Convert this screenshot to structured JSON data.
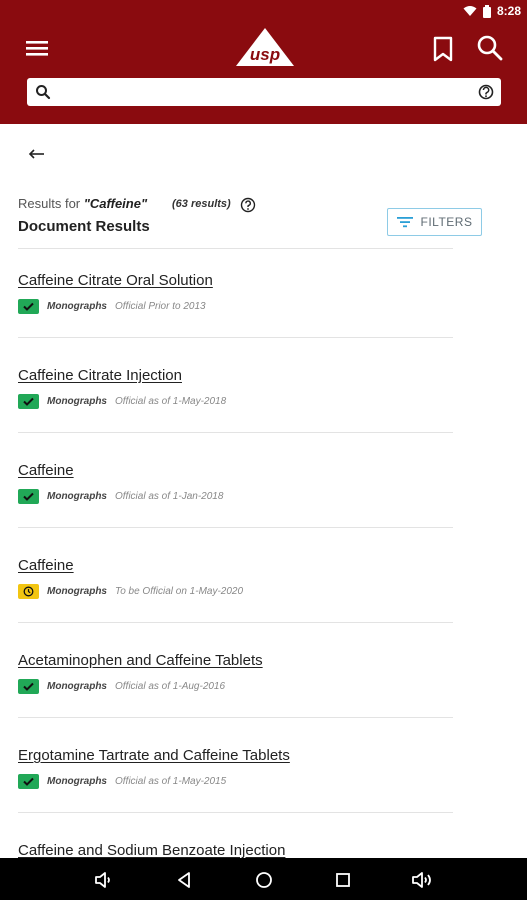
{
  "status_bar": {
    "time": "8:28"
  },
  "search": {
    "value": "",
    "placeholder": ""
  },
  "results": {
    "prefix": "Results for ",
    "term": "\"Caffeine\"",
    "count": "(63 results)",
    "section_title": "Document Results",
    "filters_label": "FILTERS"
  },
  "items": [
    {
      "title": "Caffeine Citrate Oral Solution",
      "type": "Monographs",
      "status": "Official Prior to 2013",
      "badge": "check"
    },
    {
      "title": "Caffeine Citrate Injection",
      "type": "Monographs",
      "status": "Official as of 1-May-2018",
      "badge": "check"
    },
    {
      "title": "Caffeine",
      "type": "Monographs",
      "status": "Official as of 1-Jan-2018",
      "badge": "check"
    },
    {
      "title": "Caffeine",
      "type": "Monographs",
      "status": "To be Official on 1-May-2020",
      "badge": "clock"
    },
    {
      "title": "Acetaminophen and Caffeine Tablets",
      "type": "Monographs",
      "status": "Official as of 1-Aug-2016",
      "badge": "check"
    },
    {
      "title": "Ergotamine Tartrate and Caffeine Tablets",
      "type": "Monographs",
      "status": "Official as of 1-May-2015",
      "badge": "check"
    },
    {
      "title": "Caffeine and Sodium Benzoate Injection",
      "type": "",
      "status": "",
      "badge": ""
    }
  ],
  "colors": {
    "header": "#8a0b0f",
    "badge_official": "#21a857",
    "badge_pending": "#f2c511",
    "filters_border": "#8ecbe6"
  },
  "icons": {
    "menu": "hamburger-icon",
    "logo": "usp-logo",
    "bookmark": "bookmark-icon",
    "search": "search-icon",
    "clear": "clear-icon",
    "back": "arrow-left-icon",
    "help": "help-icon",
    "filter": "filter-icon"
  }
}
